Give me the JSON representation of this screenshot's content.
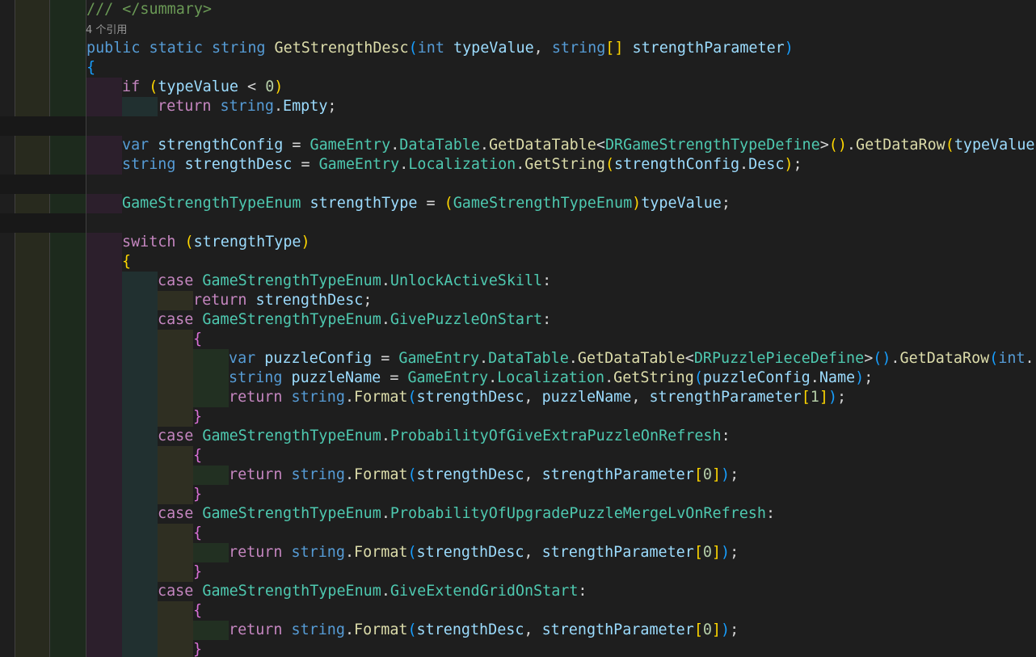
{
  "colors": {
    "background": "#1e1e1e",
    "keyword": "#569cd6",
    "control": "#c586c0",
    "type": "#4ec9b0",
    "function": "#dcdcaa",
    "variable": "#9cdcfe",
    "number": "#b5cea8",
    "comment": "#6a9955",
    "punctuation": "#d4d4d4",
    "bracket_gold": "#ffd700",
    "bracket_pink": "#da70d6",
    "bracket_blue": "#179fff",
    "codelens": "#999999"
  },
  "editor": {
    "codelens": "4 个引用",
    "lines": [
      {
        "kind": "code",
        "indent": 0,
        "tokens": [
          [
            "/// </summary>",
            "cmt"
          ]
        ]
      },
      {
        "kind": "lens"
      },
      {
        "kind": "code",
        "indent": 0,
        "tokens": [
          [
            "public",
            "kw"
          ],
          [
            " ",
            "op"
          ],
          [
            "static",
            "kw"
          ],
          [
            " ",
            "op"
          ],
          [
            "string",
            "kw"
          ],
          [
            " ",
            "op"
          ],
          [
            "GetStrengthDesc",
            "fn"
          ],
          [
            "(",
            "b3"
          ],
          [
            "int",
            "kw"
          ],
          [
            " ",
            "op"
          ],
          [
            "typeValue",
            "var"
          ],
          [
            ", ",
            "op"
          ],
          [
            "string",
            "kw"
          ],
          [
            "[]",
            "b1"
          ],
          [
            " ",
            "op"
          ],
          [
            "strengthParameter",
            "var"
          ],
          [
            ")",
            "b3"
          ]
        ]
      },
      {
        "kind": "code",
        "indent": 0,
        "tokens": [
          [
            "{",
            "b3"
          ]
        ]
      },
      {
        "kind": "code",
        "indent": 1,
        "tokens": [
          [
            "if",
            "ctrl"
          ],
          [
            " ",
            "op"
          ],
          [
            "(",
            "b1"
          ],
          [
            "typeValue",
            "var"
          ],
          [
            " < ",
            "op"
          ],
          [
            "0",
            "num"
          ],
          [
            ")",
            "b1"
          ]
        ]
      },
      {
        "kind": "code",
        "indent": 2,
        "tokens": [
          [
            "return",
            "ctrl"
          ],
          [
            " ",
            "op"
          ],
          [
            "string",
            "kw"
          ],
          [
            ".",
            "op"
          ],
          [
            "Empty",
            "var"
          ],
          [
            ";",
            "op"
          ]
        ]
      },
      {
        "kind": "blank"
      },
      {
        "kind": "code",
        "indent": 1,
        "tokens": [
          [
            "var",
            "kw"
          ],
          [
            " ",
            "op"
          ],
          [
            "strengthConfig",
            "var"
          ],
          [
            " = ",
            "op"
          ],
          [
            "GameEntry",
            "type"
          ],
          [
            ".",
            "op"
          ],
          [
            "DataTable",
            "type"
          ],
          [
            ".",
            "op"
          ],
          [
            "GetDataTable",
            "fn"
          ],
          [
            "<",
            "op"
          ],
          [
            "DRGameStrengthTypeDefine",
            "type"
          ],
          [
            ">",
            "op"
          ],
          [
            "()",
            "b1"
          ],
          [
            ".",
            "op"
          ],
          [
            "GetDataRow",
            "fn"
          ],
          [
            "(",
            "b1"
          ],
          [
            "typeValue",
            "var"
          ]
        ]
      },
      {
        "kind": "code",
        "indent": 1,
        "tokens": [
          [
            "string",
            "kw"
          ],
          [
            " ",
            "op"
          ],
          [
            "strengthDesc",
            "var"
          ],
          [
            " = ",
            "op"
          ],
          [
            "GameEntry",
            "type"
          ],
          [
            ".",
            "op"
          ],
          [
            "Localization",
            "type"
          ],
          [
            ".",
            "op"
          ],
          [
            "GetString",
            "fn"
          ],
          [
            "(",
            "b1"
          ],
          [
            "strengthConfig",
            "var"
          ],
          [
            ".",
            "op"
          ],
          [
            "Desc",
            "var"
          ],
          [
            ")",
            "b1"
          ],
          [
            ";",
            "op"
          ]
        ]
      },
      {
        "kind": "blank"
      },
      {
        "kind": "code",
        "indent": 1,
        "tokens": [
          [
            "GameStrengthTypeEnum",
            "type"
          ],
          [
            " ",
            "op"
          ],
          [
            "strengthType",
            "var"
          ],
          [
            " = ",
            "op"
          ],
          [
            "(",
            "b1"
          ],
          [
            "GameStrengthTypeEnum",
            "type"
          ],
          [
            ")",
            "b1"
          ],
          [
            "typeValue",
            "var"
          ],
          [
            ";",
            "op"
          ]
        ]
      },
      {
        "kind": "blank"
      },
      {
        "kind": "code",
        "indent": 1,
        "tokens": [
          [
            "switch",
            "ctrl"
          ],
          [
            " ",
            "op"
          ],
          [
            "(",
            "b1"
          ],
          [
            "strengthType",
            "var"
          ],
          [
            ")",
            "b1"
          ]
        ]
      },
      {
        "kind": "code",
        "indent": 1,
        "tokens": [
          [
            "{",
            "b1"
          ]
        ]
      },
      {
        "kind": "code",
        "indent": 2,
        "tokens": [
          [
            "case",
            "ctrl"
          ],
          [
            " ",
            "op"
          ],
          [
            "GameStrengthTypeEnum",
            "type"
          ],
          [
            ".",
            "op"
          ],
          [
            "UnlockActiveSkill",
            "type"
          ],
          [
            ":",
            "op"
          ]
        ]
      },
      {
        "kind": "code",
        "indent": 3,
        "tokens": [
          [
            "return",
            "ctrl"
          ],
          [
            " ",
            "op"
          ],
          [
            "strengthDesc",
            "var"
          ],
          [
            ";",
            "op"
          ]
        ]
      },
      {
        "kind": "code",
        "indent": 2,
        "tokens": [
          [
            "case",
            "ctrl"
          ],
          [
            " ",
            "op"
          ],
          [
            "GameStrengthTypeEnum",
            "type"
          ],
          [
            ".",
            "op"
          ],
          [
            "GivePuzzleOnStart",
            "type"
          ],
          [
            ":",
            "op"
          ]
        ]
      },
      {
        "kind": "code",
        "indent": 3,
        "tokens": [
          [
            "{",
            "b2"
          ]
        ]
      },
      {
        "kind": "code",
        "indent": 4,
        "tokens": [
          [
            "var",
            "kw"
          ],
          [
            " ",
            "op"
          ],
          [
            "puzzleConfig",
            "var"
          ],
          [
            " = ",
            "op"
          ],
          [
            "GameEntry",
            "type"
          ],
          [
            ".",
            "op"
          ],
          [
            "DataTable",
            "type"
          ],
          [
            ".",
            "op"
          ],
          [
            "GetDataTable",
            "fn"
          ],
          [
            "<",
            "op"
          ],
          [
            "DRPuzzlePieceDefine",
            "type"
          ],
          [
            ">",
            "op"
          ],
          [
            "()",
            "b3"
          ],
          [
            ".",
            "op"
          ],
          [
            "GetDataRow",
            "fn"
          ],
          [
            "(",
            "b3"
          ],
          [
            "int",
            "kw"
          ],
          [
            ".",
            "op"
          ]
        ]
      },
      {
        "kind": "code",
        "indent": 4,
        "tokens": [
          [
            "string",
            "kw"
          ],
          [
            " ",
            "op"
          ],
          [
            "puzzleName",
            "var"
          ],
          [
            " = ",
            "op"
          ],
          [
            "GameEntry",
            "type"
          ],
          [
            ".",
            "op"
          ],
          [
            "Localization",
            "type"
          ],
          [
            ".",
            "op"
          ],
          [
            "GetString",
            "fn"
          ],
          [
            "(",
            "b3"
          ],
          [
            "puzzleConfig",
            "var"
          ],
          [
            ".",
            "op"
          ],
          [
            "Name",
            "var"
          ],
          [
            ")",
            "b3"
          ],
          [
            ";",
            "op"
          ]
        ]
      },
      {
        "kind": "code",
        "indent": 4,
        "tokens": [
          [
            "return",
            "ctrl"
          ],
          [
            " ",
            "op"
          ],
          [
            "string",
            "kw"
          ],
          [
            ".",
            "op"
          ],
          [
            "Format",
            "fn"
          ],
          [
            "(",
            "b3"
          ],
          [
            "strengthDesc",
            "var"
          ],
          [
            ", ",
            "op"
          ],
          [
            "puzzleName",
            "var"
          ],
          [
            ", ",
            "op"
          ],
          [
            "strengthParameter",
            "var"
          ],
          [
            "[",
            "b1"
          ],
          [
            "1",
            "num"
          ],
          [
            "]",
            "b1"
          ],
          [
            ")",
            "b3"
          ],
          [
            ";",
            "op"
          ]
        ]
      },
      {
        "kind": "code",
        "indent": 3,
        "tokens": [
          [
            "}",
            "b2"
          ]
        ]
      },
      {
        "kind": "code",
        "indent": 2,
        "tokens": [
          [
            "case",
            "ctrl"
          ],
          [
            " ",
            "op"
          ],
          [
            "GameStrengthTypeEnum",
            "type"
          ],
          [
            ".",
            "op"
          ],
          [
            "ProbabilityOfGiveExtraPuzzleOnRefresh",
            "type"
          ],
          [
            ":",
            "op"
          ]
        ]
      },
      {
        "kind": "code",
        "indent": 3,
        "tokens": [
          [
            "{",
            "b2"
          ]
        ]
      },
      {
        "kind": "code",
        "indent": 4,
        "tokens": [
          [
            "return",
            "ctrl"
          ],
          [
            " ",
            "op"
          ],
          [
            "string",
            "kw"
          ],
          [
            ".",
            "op"
          ],
          [
            "Format",
            "fn"
          ],
          [
            "(",
            "b3"
          ],
          [
            "strengthDesc",
            "var"
          ],
          [
            ", ",
            "op"
          ],
          [
            "strengthParameter",
            "var"
          ],
          [
            "[",
            "b1"
          ],
          [
            "0",
            "num"
          ],
          [
            "]",
            "b1"
          ],
          [
            ")",
            "b3"
          ],
          [
            ";",
            "op"
          ]
        ]
      },
      {
        "kind": "code",
        "indent": 3,
        "tokens": [
          [
            "}",
            "b2"
          ]
        ]
      },
      {
        "kind": "code",
        "indent": 2,
        "tokens": [
          [
            "case",
            "ctrl"
          ],
          [
            " ",
            "op"
          ],
          [
            "GameStrengthTypeEnum",
            "type"
          ],
          [
            ".",
            "op"
          ],
          [
            "ProbabilityOfUpgradePuzzleMergeLvOnRefresh",
            "type"
          ],
          [
            ":",
            "op"
          ]
        ]
      },
      {
        "kind": "code",
        "indent": 3,
        "tokens": [
          [
            "{",
            "b2"
          ]
        ]
      },
      {
        "kind": "code",
        "indent": 4,
        "tokens": [
          [
            "return",
            "ctrl"
          ],
          [
            " ",
            "op"
          ],
          [
            "string",
            "kw"
          ],
          [
            ".",
            "op"
          ],
          [
            "Format",
            "fn"
          ],
          [
            "(",
            "b3"
          ],
          [
            "strengthDesc",
            "var"
          ],
          [
            ", ",
            "op"
          ],
          [
            "strengthParameter",
            "var"
          ],
          [
            "[",
            "b1"
          ],
          [
            "0",
            "num"
          ],
          [
            "]",
            "b1"
          ],
          [
            ")",
            "b3"
          ],
          [
            ";",
            "op"
          ]
        ]
      },
      {
        "kind": "code",
        "indent": 3,
        "tokens": [
          [
            "}",
            "b2"
          ]
        ]
      },
      {
        "kind": "code",
        "indent": 2,
        "tokens": [
          [
            "case",
            "ctrl"
          ],
          [
            " ",
            "op"
          ],
          [
            "GameStrengthTypeEnum",
            "type"
          ],
          [
            ".",
            "op"
          ],
          [
            "GiveExtendGridOnStart",
            "type"
          ],
          [
            ":",
            "op"
          ]
        ]
      },
      {
        "kind": "code",
        "indent": 3,
        "tokens": [
          [
            "{",
            "b2"
          ]
        ]
      },
      {
        "kind": "code",
        "indent": 4,
        "tokens": [
          [
            "return",
            "ctrl"
          ],
          [
            " ",
            "op"
          ],
          [
            "string",
            "kw"
          ],
          [
            ".",
            "op"
          ],
          [
            "Format",
            "fn"
          ],
          [
            "(",
            "b3"
          ],
          [
            "strengthDesc",
            "var"
          ],
          [
            ", ",
            "op"
          ],
          [
            "strengthParameter",
            "var"
          ],
          [
            "[",
            "b1"
          ],
          [
            "0",
            "num"
          ],
          [
            "]",
            "b1"
          ],
          [
            ")",
            "b3"
          ],
          [
            ";",
            "op"
          ]
        ]
      },
      {
        "kind": "code",
        "indent": 3,
        "tokens": [
          [
            "}",
            "b2"
          ]
        ]
      }
    ]
  }
}
